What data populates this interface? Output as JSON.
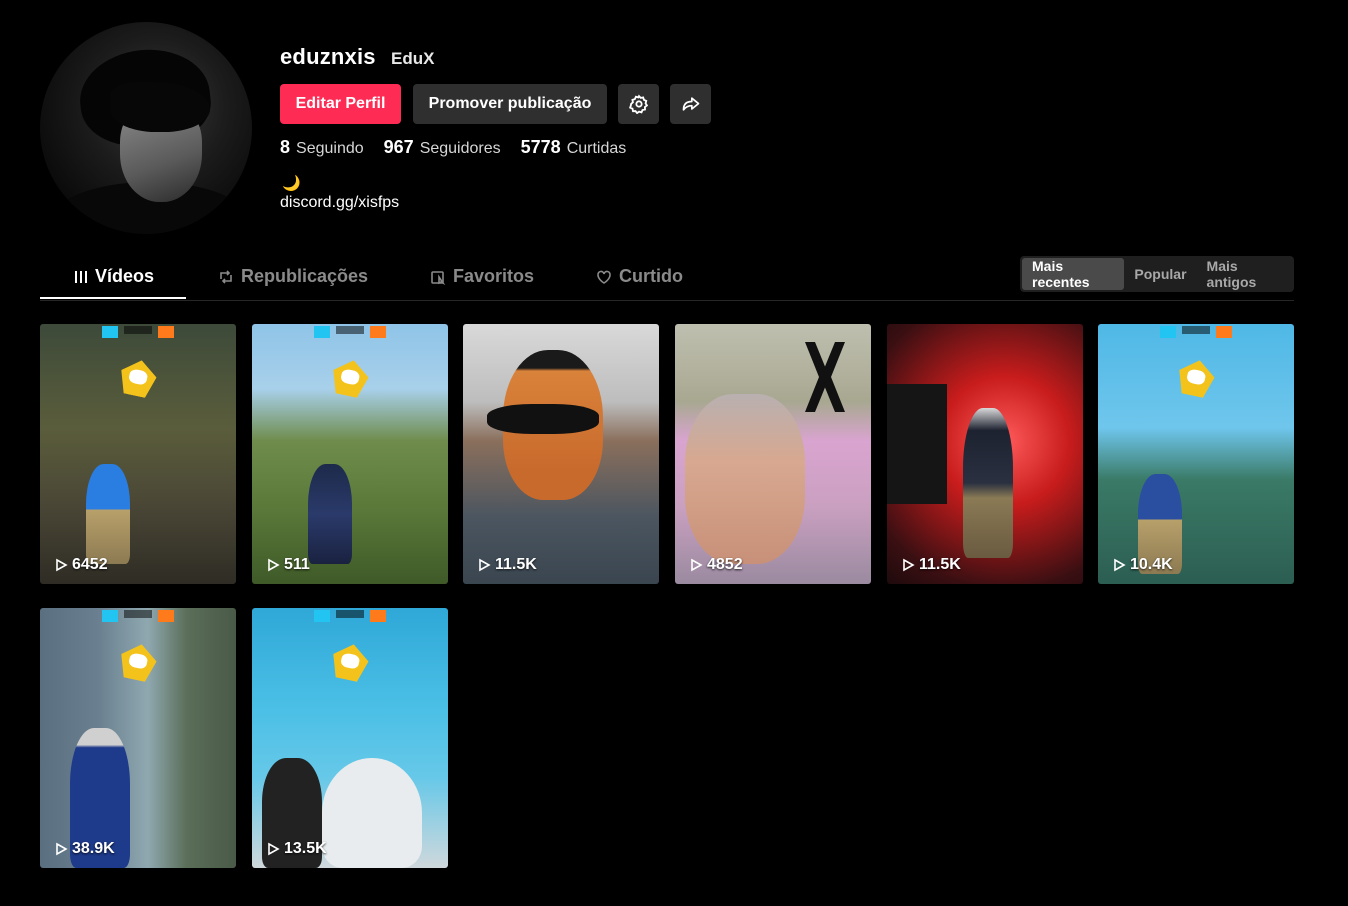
{
  "profile": {
    "username": "eduznxis",
    "nickname": "EduX",
    "edit_label": "Editar Perfil",
    "promote_label": "Promover publicação",
    "bio_emoji": "🌙",
    "bio_link": "discord.gg/xisfps"
  },
  "stats": [
    {
      "value": "8",
      "label": "Seguindo"
    },
    {
      "value": "967",
      "label": "Seguidores"
    },
    {
      "value": "5778",
      "label": "Curtidas"
    }
  ],
  "tabs": [
    {
      "label": "Vídeos",
      "icon": "grid-icon",
      "active": true
    },
    {
      "label": "Republicações",
      "icon": "repost-icon",
      "active": false
    },
    {
      "label": "Favoritos",
      "icon": "bookmark-icon",
      "active": false
    },
    {
      "label": "Curtido",
      "icon": "heart-icon",
      "active": false
    }
  ],
  "sort": [
    {
      "label": "Mais recentes",
      "active": true
    },
    {
      "label": "Popular",
      "active": false
    },
    {
      "label": "Mais antigos",
      "active": false
    }
  ],
  "videos": [
    {
      "views": "6452"
    },
    {
      "views": "511"
    },
    {
      "views": "11.5K"
    },
    {
      "views": "4852"
    },
    {
      "views": "11.5K"
    },
    {
      "views": "10.4K"
    },
    {
      "views": "38.9K"
    },
    {
      "views": "13.5K"
    }
  ],
  "colors": {
    "accent": "#fe2c55",
    "button_dark": "#2f2f2f",
    "background": "#000000"
  }
}
